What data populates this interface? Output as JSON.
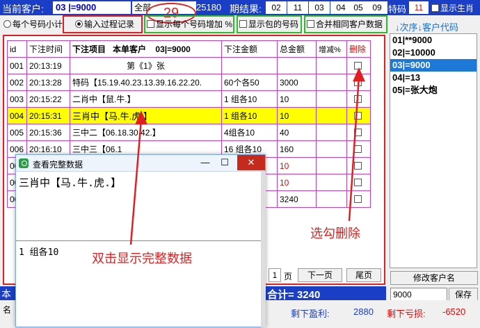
{
  "topbar": {
    "current_customer_label": "当前客户:",
    "current_customer_value": "03 |=9000",
    "filter_value": "全部",
    "filter_number": "25180",
    "result_label": "期结果:",
    "results": [
      "02",
      "11",
      "03",
      "04",
      "05",
      "09"
    ],
    "special_label": "特码",
    "special_value": "11",
    "show_zodiac_label": "显示生肖"
  },
  "annotation_number": "29",
  "options": {
    "per_number_subtotal": "每个号码小计",
    "input_process_record": "输入过程记录",
    "show_per_number_increase": "显示每个号码增加",
    "percent": "%",
    "show_included_numbers": "显示包的号码",
    "merge_same_customer": "合并相同客户数据"
  },
  "table": {
    "headers": {
      "id": "id",
      "time": "下注时间",
      "item": "下注项目",
      "customer_label": "本单客户",
      "customer_value": "03|=9000",
      "amount": "下注金额",
      "total": "总金额",
      "change": "增减%",
      "delete": "删除"
    },
    "rows": [
      {
        "id": "001",
        "time": "20:13:19",
        "item": "第《1》张",
        "amount": "",
        "total": "",
        "change": ""
      },
      {
        "id": "002",
        "time": "20:13:28",
        "item": "特码【15.19.40.23.13.39.16.22.20.",
        "amount": "60个各50",
        "total": "3000",
        "change": ""
      },
      {
        "id": "003",
        "time": "20:15:22",
        "item": "二肖中【鼠.牛.】",
        "amount": "1 组各10",
        "total": "10",
        "change": ""
      },
      {
        "id": "004",
        "time": "20:15:31",
        "item": "三肖中【马.牛.虎.】",
        "amount": "1 组各10",
        "total": "10",
        "change": ""
      },
      {
        "id": "005",
        "time": "20:15:36",
        "item": "三中二【06.18.30.42.】",
        "amount": "4组各10",
        "total": "40",
        "change": ""
      },
      {
        "id": "006",
        "time": "20:16:10",
        "item": "三中三【06.1",
        "amount": "16 组各10",
        "total": "160",
        "change": ""
      },
      {
        "id": "007",
        "time": "",
        "item": "",
        "amount": "",
        "total": "10",
        "change": ""
      },
      {
        "id": "008",
        "time": "",
        "item": "",
        "amount": "",
        "total": "10",
        "change": ""
      },
      {
        "id": "009",
        "time": "",
        "item": "",
        "amount": "",
        "total": "3240",
        "change": ""
      }
    ]
  },
  "pager": {
    "page": "1",
    "page_unit": "页",
    "next": "下一页",
    "last": "尾页"
  },
  "right_panel": {
    "order_link": "↓次序↓客户代码",
    "customers": [
      "01|**9000",
      "02|=10000",
      "03|=9000",
      "04|=13",
      "05|=张大炮"
    ],
    "selected_index": 2,
    "rename_button": "修改客户名",
    "name_input": "9000",
    "save_button": "保存"
  },
  "totalbar": {
    "prefix": "本",
    "total": "合计= 3240"
  },
  "bottombar": {
    "prefix": "名",
    "remaining_profit_label": "剩下盈利:",
    "remaining_profit_value": "2880",
    "remaining_loss_label": "剩下亏损:",
    "remaining_loss_value": "-6520"
  },
  "popup": {
    "title": "查看完整数据",
    "top_text": "三肖中【马.牛.虎.】",
    "bottom_text": "1 组各10",
    "minimize": "—",
    "maximize": "☐",
    "close": "✕"
  },
  "annotations": {
    "tick_delete": "选勾删除",
    "double_click": "双击显示完整数据"
  },
  "colors": {
    "accent_blue": "#1a3fc6",
    "highlight_yellow": "#ffff00",
    "annotation_red": "#e02020",
    "selected_blue": "#1e78d7"
  }
}
